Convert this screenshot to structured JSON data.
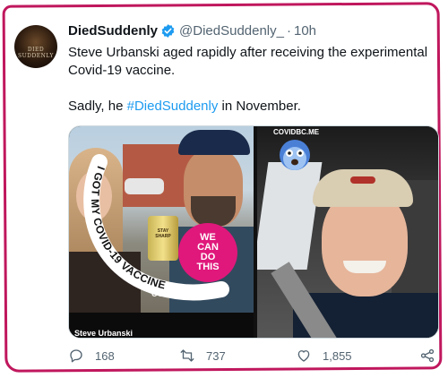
{
  "tweet": {
    "display_name": "DiedSuddenly",
    "handle": "@DiedSuddenly_",
    "separator": "·",
    "time": "10h",
    "avatar_text": "DIED SUDDENLY",
    "text_line1": "Steve Urbanski aged rapidly after receiving the experimental",
    "text_line2": "Covid-19 vaccine.",
    "text_line3_before": "Sadly, he ",
    "hashtag": "#DiedSuddenly",
    "text_line3_after": " in November."
  },
  "media": {
    "left_arc_text": "I GOT MY COVID-19 VACCINE",
    "badge_line1": "WE",
    "badge_line2": "CAN",
    "badge_line3": "DO",
    "badge_line4": "THIS",
    "can_label": "STAY SHARP",
    "watermark_left": "COVIDBC.ME",
    "caption_name": "Steve Urbanski",
    "watermark_right": "COVIDBC.ME"
  },
  "actions": {
    "replies": "168",
    "retweets": "737",
    "likes": "1,855"
  },
  "icons": {
    "verified": "verified-badge-icon",
    "reply": "reply-icon",
    "retweet": "retweet-icon",
    "like": "heart-icon",
    "share": "share-icon",
    "emoji": "shocked-face-emoji"
  },
  "colors": {
    "frame": "#c0175d",
    "link": "#1d9bf0",
    "verified": "#1d9bf0",
    "badge": "#e0187b",
    "muted": "#536471"
  }
}
